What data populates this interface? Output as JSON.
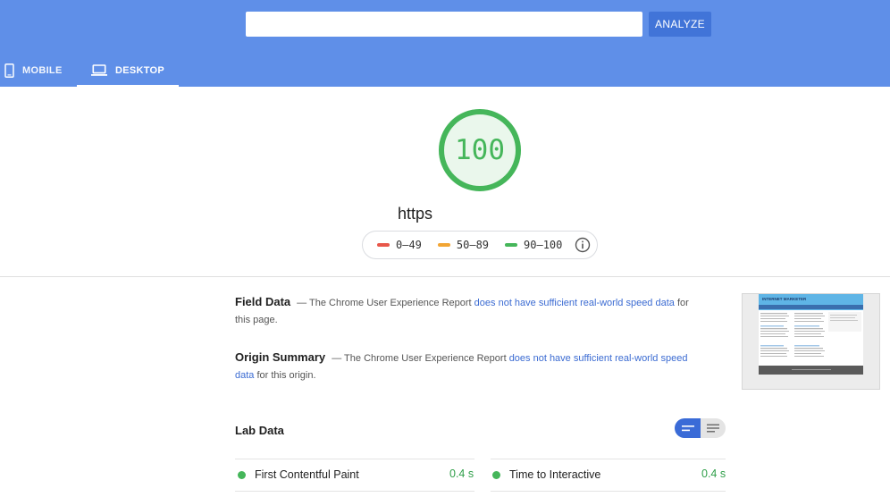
{
  "search": {
    "value": "",
    "placeholder": ""
  },
  "analyze_label": "ANALYZE",
  "tabs": [
    {
      "label": "MOBILE",
      "icon": "mobile-phone-icon"
    },
    {
      "label": "DESKTOP",
      "icon": "laptop-icon",
      "selected": true
    }
  ],
  "score": {
    "value": "100",
    "progress": 1.0,
    "color": "#45b65a"
  },
  "page_url": "https",
  "legend": [
    {
      "range": "0–49",
      "color": "#e8574a"
    },
    {
      "range": "50–89",
      "color": "#f2a533"
    },
    {
      "range": "90–100",
      "color": "#45b65a"
    }
  ],
  "field_data": {
    "title": "Field Data",
    "pre": " — The Chrome User Experience Report ",
    "link": "does not have sufficient real-world speed data",
    "post": " for this page."
  },
  "origin_summary": {
    "title": "Origin Summary",
    "pre": " — The Chrome User Experience Report ",
    "link": "does not have sufficient real-world speed data",
    "post": " for this origin."
  },
  "thumbnail": {
    "site_title": "INTERNET MARKETER"
  },
  "lab_data": {
    "title": "Lab Data",
    "metrics": [
      {
        "label": "First Contentful Paint",
        "value": "0.4 s"
      },
      {
        "label": "Time to Interactive",
        "value": "0.4 s"
      }
    ]
  },
  "colors": {
    "header": "#5f8fe8",
    "accent": "#3a6bd7",
    "good": "#45b65a"
  }
}
